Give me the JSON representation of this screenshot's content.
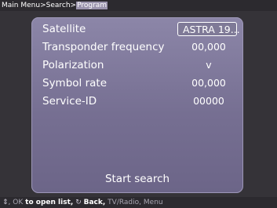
{
  "breadcrumb": {
    "items": [
      "Main Menu",
      "Search",
      "Program"
    ],
    "separator": ">"
  },
  "rows": [
    {
      "label": "Satellite",
      "value": "ASTRA 19..."
    },
    {
      "label": "Transponder frequency",
      "value": "00,000"
    },
    {
      "label": "Polarization",
      "value": "v"
    },
    {
      "label": "Symbol rate",
      "value": "00,000"
    },
    {
      "label": "Service-ID",
      "value": "00000"
    }
  ],
  "start_search": "Start search",
  "footer": {
    "nav_icon": "up-down-arrows-icon",
    "comma": ",",
    "ok_label": "OK",
    "open_list": "to open list,",
    "back_icon": "back-arrow-icon",
    "back_label": "Back,",
    "tvradio_label": "TV/Radio,",
    "menu_label": "Menu"
  },
  "colors": {
    "background": "#353338",
    "panel": "#7a7496",
    "bar": "#2c2a2f",
    "highlight": "#9b94ad"
  }
}
